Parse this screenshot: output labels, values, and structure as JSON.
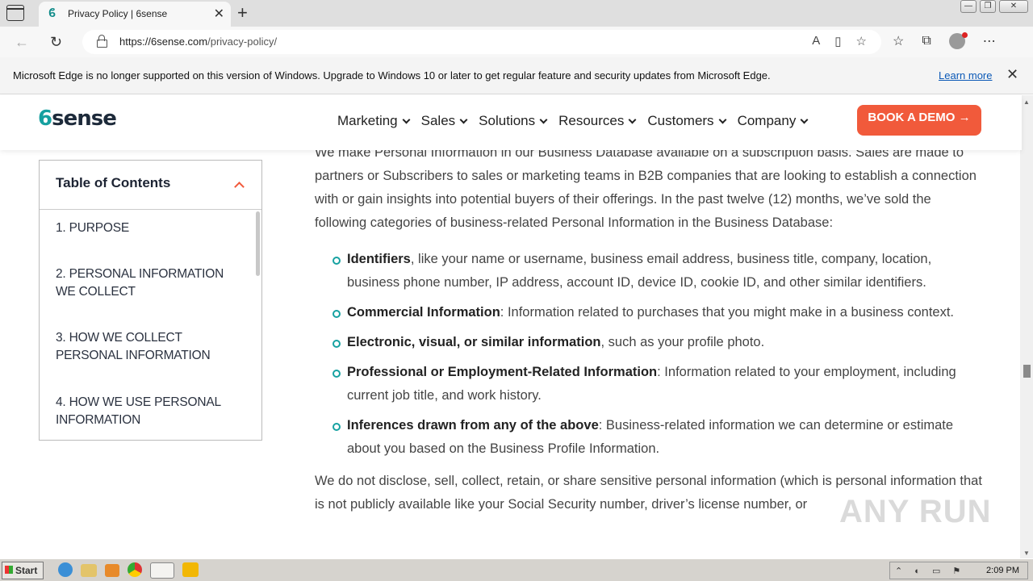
{
  "browser": {
    "tab_title": "Privacy Policy | 6sense",
    "url_host": "https://6sense.com",
    "url_path": "/privacy-policy/"
  },
  "infobar": {
    "message": "Microsoft Edge is no longer supported on this version of Windows. Upgrade to Windows 10 or later to get regular feature and security updates from Microsoft Edge.",
    "link": "Learn more"
  },
  "site": {
    "logo_six": "6",
    "logo_text": "sense",
    "nav": [
      "Marketing",
      "Sales",
      "Solutions",
      "Resources",
      "Customers",
      "Company"
    ],
    "cta": "BOOK A DEMO →"
  },
  "toc": {
    "title": "Table of Contents",
    "items": [
      "1. PURPOSE",
      "2. PERSONAL INFORMATION WE COLLECT",
      "3. HOW WE COLLECT PERSONAL INFORMATION",
      "4. HOW WE USE PERSONAL INFORMATION"
    ]
  },
  "article": {
    "intro": "We make Personal Information in our Business Database available on a subscription basis. Sales are made to partners or Subscribers to sales or marketing teams in B2B companies that are looking to establish a connection with or gain insights into potential buyers of their offerings. In the past twelve (12) months, we’ve sold the following categories of business-related Personal Information in the Business Database:",
    "bullets": [
      {
        "term": "Identifiers",
        "text": ", like your name or username, business email address, business title, company, location, business phone number, IP address, account ID, device ID, cookie ID, and other similar identifiers."
      },
      {
        "term": "Commercial Information",
        "text": ": Information related to purchases that you might make in a business context."
      },
      {
        "term": "Electronic, visual, or similar information",
        "text": ", such as your profile photo."
      },
      {
        "term": "Professional or Employment-Related Information",
        "text": ": Information related to your employment, including current job title, and work history."
      },
      {
        "term": "Inferences drawn from any of the above",
        "text": ": Business-related information we can determine or estimate about you based on the Business Profile Information."
      }
    ],
    "closing": "We do not disclose, sell, collect, retain, or share sensitive personal information (which is personal information that is not publicly available like your Social Security number, driver’s license number, or"
  },
  "watermark": "ANY RUN",
  "taskbar": {
    "start": "Start",
    "clock": "2:09 PM"
  },
  "colors": {
    "accent": "#f15a3b",
    "teal": "#17a2a2"
  }
}
